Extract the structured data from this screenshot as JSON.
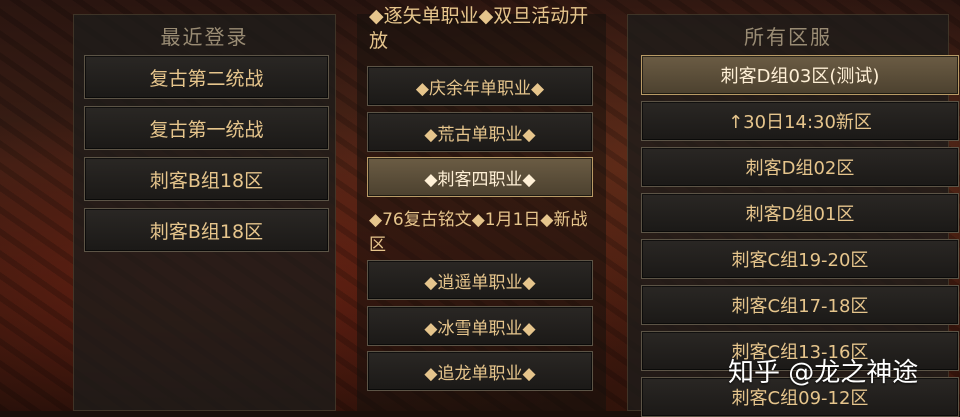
{
  "recent": {
    "title": "最近登录",
    "items": [
      "复古第二统战",
      "复古第一统战",
      "刺客B组18区",
      "刺客B组18区"
    ]
  },
  "categories": {
    "items": [
      "◆逐矢单职业◆双旦活动开放",
      "◆庆余年单职业◆",
      "◆荒古单职业◆",
      "◆刺客四职业◆",
      "◆76复古铭文◆1月1日◆新战区",
      "◆逍遥单职业◆",
      "◆冰雪单职业◆",
      "◆追龙单职业◆"
    ],
    "selected_index": 3
  },
  "servers": {
    "title": "所有区服",
    "items": [
      "刺客D组03区(测试)",
      "↑30日14:30新区",
      "刺客D组02区",
      "刺客D组01区",
      "刺客C组19-20区",
      "刺客C组17-18区",
      "刺客C组13-16区",
      "刺客C组09-12区"
    ],
    "selected_index": 0
  },
  "watermark": "知乎 @龙之神途",
  "colors": {
    "text_gold": "#e6c58c",
    "title": "#9a8c74",
    "selected": "#6b5c44"
  }
}
